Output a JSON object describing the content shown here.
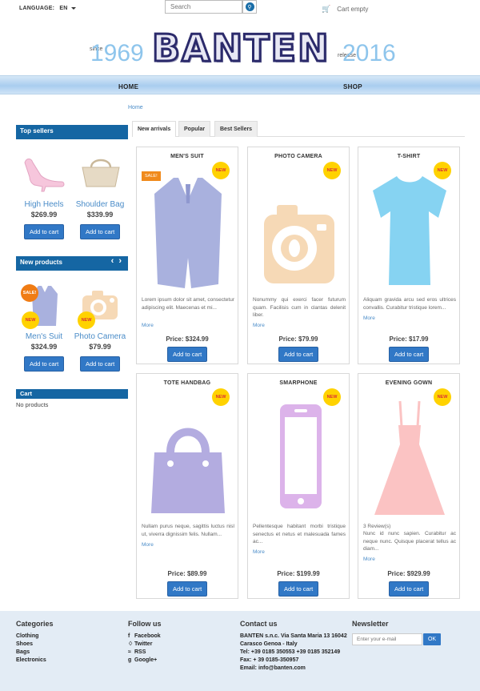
{
  "header": {
    "language_label": "LANGUAGE:",
    "language_value": "EN",
    "search_placeholder": "Search",
    "cart_label": "Cart empty"
  },
  "banner": {
    "since": "since",
    "year_start": "1969",
    "logo": "BANTEN",
    "release": "release",
    "year_end": "2016"
  },
  "nav": {
    "home": "HOME",
    "shop": "SHOP"
  },
  "breadcrumb": "Home",
  "sidebar": {
    "top_sellers_title": "Top sellers",
    "top_sellers": [
      {
        "name": "High Heels",
        "price": "$269.99",
        "button": "Add to cart"
      },
      {
        "name": "Shoulder Bag",
        "price": "$339.99",
        "button": "Add to cart"
      }
    ],
    "new_products_title": "New products",
    "new_products": [
      {
        "name": "Men's Suit",
        "price": "$324.99",
        "button": "Add to cart",
        "sale": "SALE!",
        "new": "NEW"
      },
      {
        "name": "Photo Camera",
        "price": "$79.99",
        "button": "Add to cart",
        "new": "NEW"
      }
    ],
    "cart_title": "Cart",
    "cart_empty": "No products"
  },
  "tabs": [
    "New arrivals",
    "Popular",
    "Best Sellers"
  ],
  "products": [
    {
      "name": "MEN'S SUIT",
      "badge": "NEW",
      "sale": "SALE!",
      "desc": "Lorem ipsum dolor sit amet, consectetur adipiscing elit. Maecenas et mi...",
      "more": "More",
      "price": "Price: $324.99",
      "button": "Add to cart",
      "color": "#a9b1de"
    },
    {
      "name": "PHOTO CAMERA",
      "badge": "NEW",
      "desc": "Nonummy qui exerci facer futurum quam. Facilisis cum in clantas delenit liber.",
      "more": "More",
      "price": "Price: $79.99",
      "button": "Add to cart",
      "color": "#f6d9b6"
    },
    {
      "name": "T-SHIRT",
      "badge": "NEW",
      "desc": "Aliquam gravida arcu sed eros ultrices convallis. Curabitur tristique lorem...",
      "more": "More",
      "price": "Price: $17.99",
      "button": "Add to cart",
      "color": "#86d3f2"
    },
    {
      "name": "TOTE HANDBAG",
      "badge": "NEW",
      "desc": "Nullam purus neque, sagittis luctus nisl ut, viverra dignissim felis. Nullam...",
      "more": "More",
      "price": "Price: $89.99",
      "button": "Add to cart",
      "color": "#b3ace0"
    },
    {
      "name": "SMARPHONE",
      "badge": "NEW",
      "desc": "Pellentesque habitant morbi tristique senectus et netus et malesuada fames ac...",
      "more": "More",
      "price": "Price: $199.99",
      "button": "Add to cart",
      "color": "#dcb3ea"
    },
    {
      "name": "EVENING GOWN",
      "badge": "NEW",
      "reviews": "3 Review(s)",
      "desc": "Nunc id nunc sapien. Curabitur ac neque nunc. Quisque placerat tellus ac diam...",
      "more": "More",
      "price": "Price: $929.99",
      "button": "Add to cart",
      "color": "#fbc3c3"
    }
  ],
  "footer": {
    "categories_title": "Categories",
    "categories": [
      "Clothing",
      "Shoes",
      "Bags",
      "Electronics"
    ],
    "follow_title": "Follow us",
    "follow": [
      "Facebook",
      "Twitter",
      "RSS",
      "Google+"
    ],
    "contact_title": "Contact us",
    "contact": [
      "BANTEN s.n.c. Via Santa Maria 13 16042",
      "Carasco Genoa - Italy",
      "Tel: +39 0185 350553 +39 0185 352149",
      "Fax: + 39 0185-350957",
      "Email: info@banten.com"
    ],
    "newsletter_title": "Newsletter",
    "newsletter_placeholder": "Enter your e-mail",
    "newsletter_button": "OK"
  }
}
